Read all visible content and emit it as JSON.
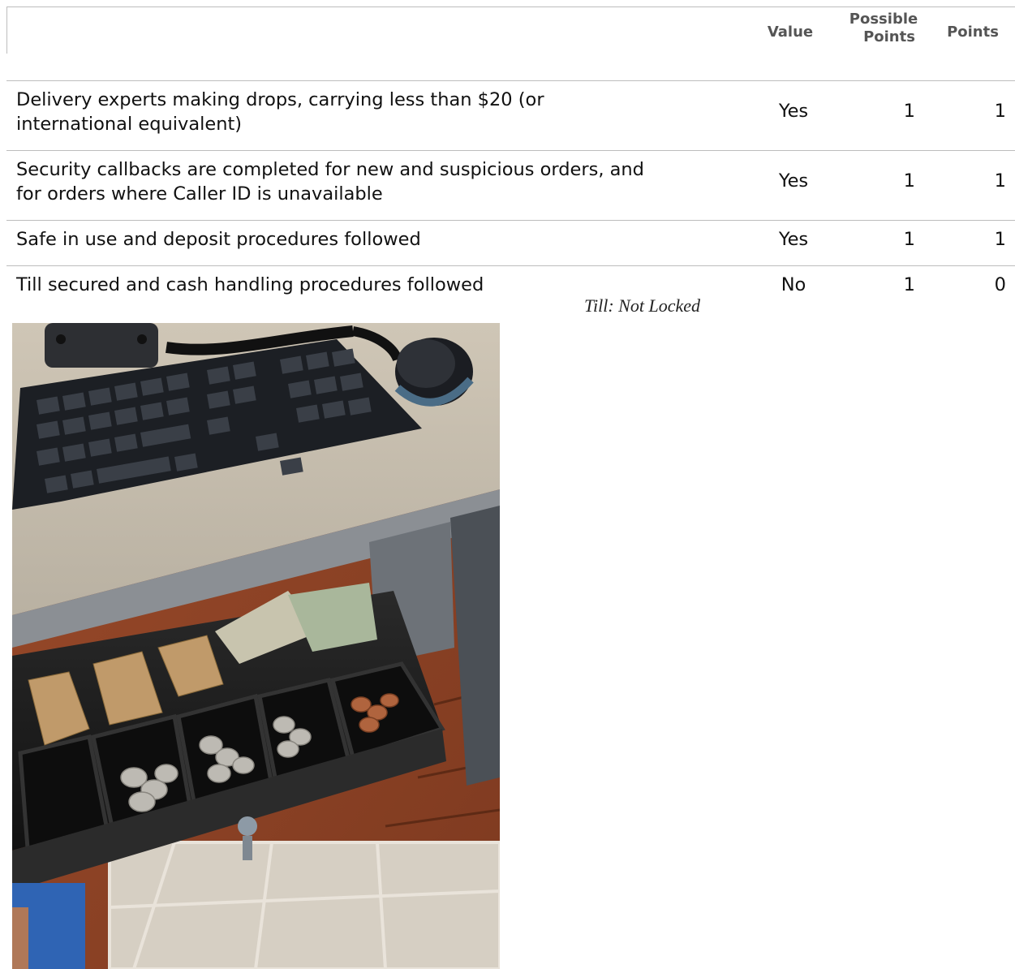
{
  "header": {
    "value": "Value",
    "possible_points_line1": "Possible",
    "possible_points_line2": "Points",
    "points": "Points"
  },
  "rows": [
    {
      "description": "Delivery experts making drops, carrying less than $20 (or international equivalent)",
      "value": "Yes",
      "possible": "1",
      "points": "1"
    },
    {
      "description": "Security callbacks are completed for new and suspicious orders, and for orders where Caller ID is unavailable",
      "value": "Yes",
      "possible": "1",
      "points": "1"
    },
    {
      "description": "Safe in use and deposit procedures followed",
      "value": "Yes",
      "possible": "1",
      "points": "1"
    },
    {
      "description": "Till secured and cash handling procedures followed",
      "value": "No",
      "possible": "1",
      "points": "0"
    }
  ],
  "comment": "Till: Not Locked",
  "photo": {
    "icon": "cash-drawer-photo"
  }
}
